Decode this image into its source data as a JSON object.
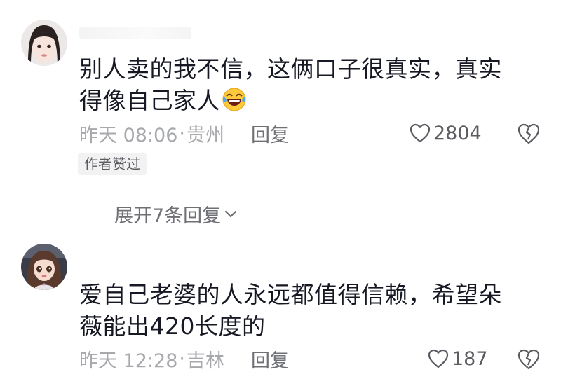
{
  "comments": [
    {
      "text_line1": "别人卖的我不信，这俩口子很真实，真实",
      "text_line2": "得像自己家人",
      "emoji": "laughing-crying-emoji",
      "time": "昨天 08:06",
      "separator": "·",
      "location": "贵州",
      "reply_label": "回复",
      "likes": "2804",
      "author_badge": "作者赞过",
      "expand_label": "展开7条回复"
    },
    {
      "text_line1": "爱自己老婆的人永远都值得信赖，希望朵",
      "text_line2": "薇能出420长度的",
      "time": "昨天 12:28",
      "separator": "·",
      "location": "吉林",
      "reply_label": "回复",
      "likes": "187"
    }
  ],
  "colors": {
    "text": "#161823",
    "meta": "#a8a9ad",
    "action": "#6f7075",
    "badge_bg": "#f2f2f3"
  },
  "icons": {
    "like": "heart-outline-icon",
    "dislike": "broken-heart-icon",
    "expand": "chevron-down-icon"
  }
}
